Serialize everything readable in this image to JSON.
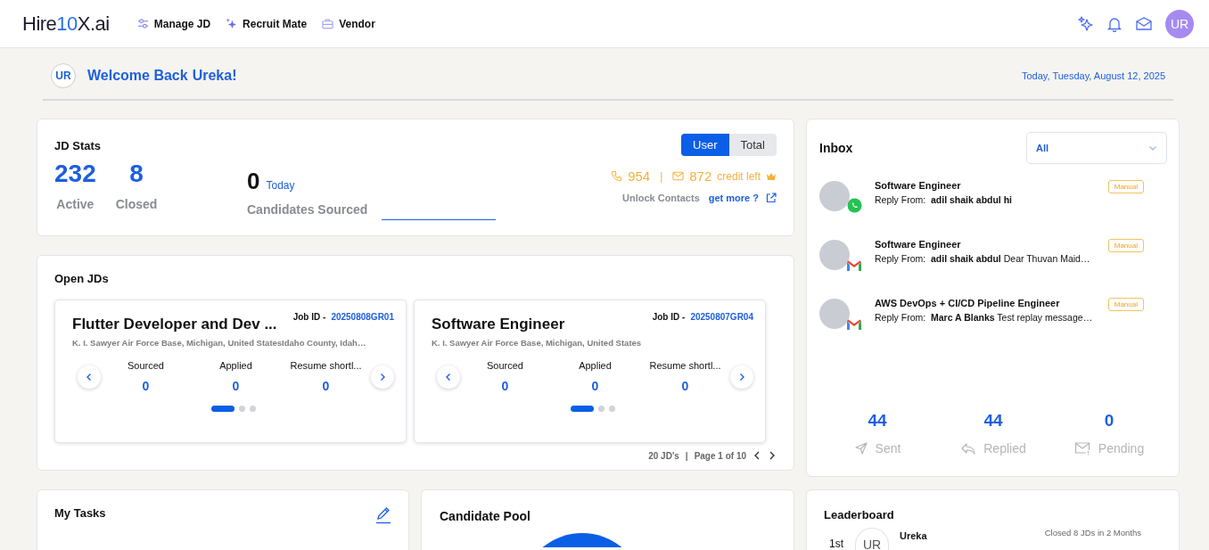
{
  "nav": {
    "logo": {
      "prefix": "Hire",
      "accent": "10",
      "suffix": "X.ai"
    },
    "items": [
      {
        "label": "Manage JD"
      },
      {
        "label": "Recruit Mate"
      },
      {
        "label": "Vendor"
      }
    ],
    "avatar": "UR"
  },
  "welcome": {
    "avatar": "UR",
    "greeting": "Welcome Back",
    "name": "Ureka!",
    "date": "Today, Tuesday, August 12, 2025"
  },
  "jd_stats": {
    "title": "JD Stats",
    "toggle": [
      {
        "label": "User",
        "selected": true
      },
      {
        "label": "Total",
        "selected": false
      }
    ],
    "stats": [
      {
        "value": "232",
        "label": "Active"
      },
      {
        "value": "8",
        "label": "Closed"
      }
    ],
    "sourced": {
      "value": "0",
      "period": "Today",
      "label": "Candidates Sourced"
    },
    "credits": {
      "phone": "954",
      "separator": "|",
      "email": "872",
      "label": "credit left"
    },
    "unlock": "Unlock Contacts",
    "get_more": "get more ?"
  },
  "open_jds": {
    "title": "Open JDs",
    "cards": [
      {
        "title": "Flutter Developer and Dev ...",
        "job_id_label": "Job ID -",
        "job_id": "20250808GR01",
        "location": "K. I. Sawyer Air Force Base, Michigan, United StatesIdaho County, Idah…",
        "metrics": [
          {
            "label": "Sourced",
            "value": "0"
          },
          {
            "label": "Applied",
            "value": "0"
          },
          {
            "label": "Resume shortl...",
            "value": "0"
          }
        ],
        "dots": [
          {
            "selected": true
          },
          {
            "selected": false
          },
          {
            "selected": false
          }
        ]
      },
      {
        "title": "Software Engineer",
        "job_id_label": "Job ID -",
        "job_id": "20250807GR04",
        "location": "K. I. Sawyer Air Force Base, Michigan, United States",
        "metrics": [
          {
            "label": "Sourced",
            "value": "0"
          },
          {
            "label": "Applied",
            "value": "0"
          },
          {
            "label": "Resume shortl...",
            "value": "0"
          }
        ],
        "dots": [
          {
            "selected": true
          },
          {
            "selected": false
          },
          {
            "selected": false
          }
        ]
      }
    ],
    "footer": {
      "count": "20 JD's",
      "separator": "|",
      "page": "Page 1 of 10"
    }
  },
  "inbox": {
    "title": "Inbox",
    "filter": "All",
    "messages": [
      {
        "title": "Software Engineer",
        "line": "Reply From:  **adil shaik abdul hi**",
        "kind": "chat",
        "tag": "Manual"
      },
      {
        "title": "Software Engineer",
        "line": "Reply From:  **adil shaik abdul** Dear Thuvan Maid…",
        "kind": "mail",
        "tag": "Manual"
      },
      {
        "title": "AWS DevOps + CI/CD Pipeline Engineer",
        "line": "Reply From:  **Marc A Blanks** Test replay message…",
        "kind": "mail",
        "tag": "Manual"
      }
    ],
    "summary": [
      {
        "value": "44",
        "label": "Sent"
      },
      {
        "value": "44",
        "label": "Replied"
      },
      {
        "value": "0",
        "label": "Pending"
      }
    ]
  },
  "tasks": {
    "title": "My Tasks"
  },
  "candidate_pool": {
    "title": "Candidate Pool"
  },
  "leaderboard": {
    "title": "Leaderboard",
    "entries": [
      {
        "rank": "1st",
        "initials": "UR",
        "name": "Ureka",
        "note": "Closed 8 JDs in 2 Months"
      }
    ]
  }
}
